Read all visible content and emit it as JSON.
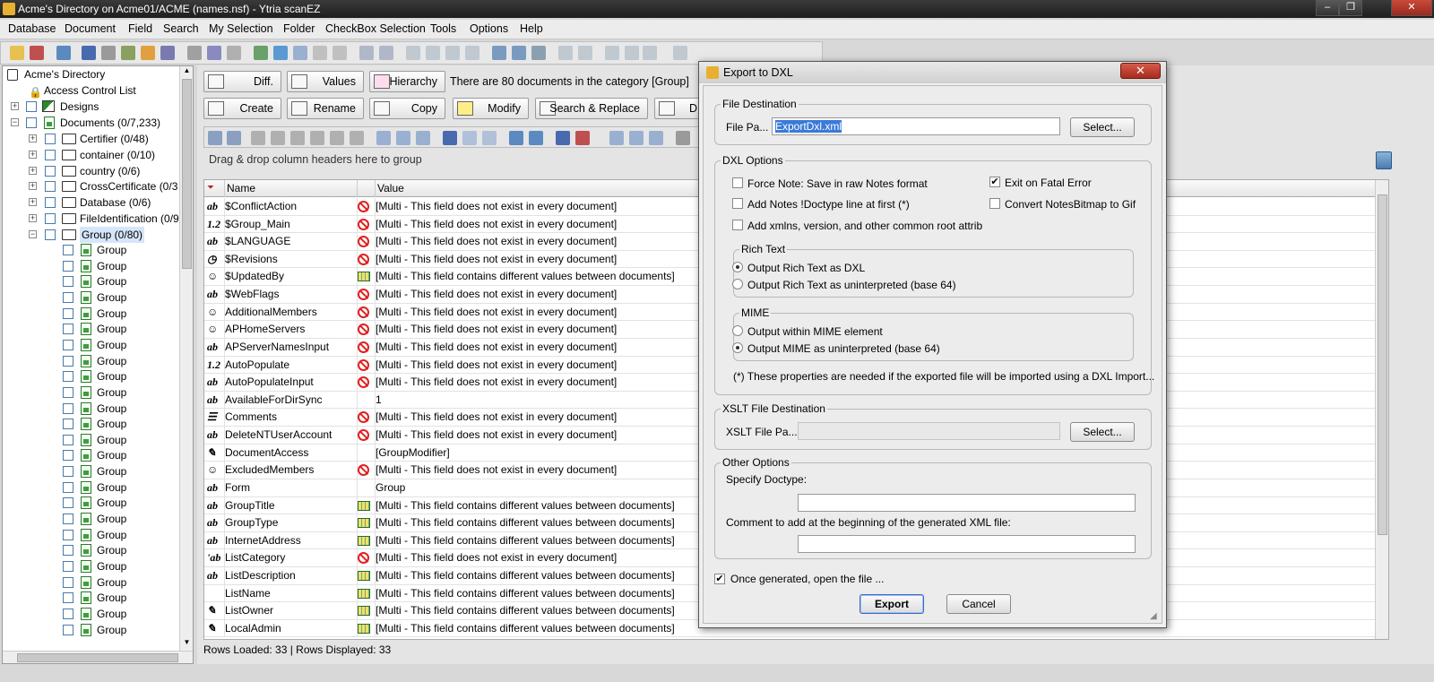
{
  "window": {
    "title": "Acme's Directory on Acme01/ACME (names.nsf) - Ytria scanEZ",
    "close": "✕",
    "maximize": "❐",
    "minimize": "–"
  },
  "menu": [
    "Database",
    "Document",
    "Field",
    "Search",
    "My Selection",
    "Folder",
    "CheckBox Selection",
    "Tools",
    "Options",
    "Help"
  ],
  "tree": {
    "root": "Acme's Directory",
    "acl": "Access Control List",
    "designs": "Designs",
    "documents": "Documents  (0/7,233)",
    "folders": [
      "Certifier  (0/48)",
      "container  (0/10)",
      "country  (0/6)",
      "CrossCertificate  (0/3",
      "Database  (0/6)",
      "FileIdentification  (0/9",
      "Group  (0/80)"
    ],
    "child_label": "Group",
    "child_count": 26
  },
  "buttons": {
    "diff": "Diff.",
    "values": "Values",
    "hierarchy": "Hierarchy",
    "create": "Create",
    "rename": "Rename",
    "copy": "Copy",
    "modify": "Modify",
    "search_replace": "Search & Replace",
    "d": "D"
  },
  "category_info": "There are 80 documents in the category [Group]",
  "group_hint": "Drag & drop column headers here to group",
  "grid": {
    "col_name": "Name",
    "col_value": "Value",
    "rows": [
      {
        "t": "ab",
        "n": "$ConflictAction",
        "i": "no",
        "v": "[Multi - This field does not exist in every document]"
      },
      {
        "t": "1.2",
        "n": "$Group_Main",
        "i": "no",
        "v": "[Multi - This field does not exist in every document]"
      },
      {
        "t": "ab",
        "n": "$LANGUAGE",
        "i": "no",
        "v": "[Multi - This field does not exist in every document]"
      },
      {
        "t": "◷",
        "n": "$Revisions",
        "i": "no",
        "v": "[Multi - This field does not exist in every document]"
      },
      {
        "t": "☺",
        "n": "$UpdatedBy",
        "i": "ml",
        "v": "[Multi - This field contains different values between documents]"
      },
      {
        "t": "ab",
        "n": "$WebFlags",
        "i": "no",
        "v": "[Multi - This field does not exist in every document]"
      },
      {
        "t": "☺",
        "n": "AdditionalMembers",
        "i": "no",
        "v": "[Multi - This field does not exist in every document]"
      },
      {
        "t": "☺",
        "n": "APHomeServers",
        "i": "no",
        "v": "[Multi - This field does not exist in every document]"
      },
      {
        "t": "ab",
        "n": "APServerNamesInput",
        "i": "no",
        "v": "[Multi - This field does not exist in every document]"
      },
      {
        "t": "1.2",
        "n": "AutoPopulate",
        "i": "no",
        "v": "[Multi - This field does not exist in every document]"
      },
      {
        "t": "ab",
        "n": "AutoPopulateInput",
        "i": "no",
        "v": "[Multi - This field does not exist in every document]"
      },
      {
        "t": "ab",
        "n": "AvailableForDirSync",
        "i": "",
        "v": "1"
      },
      {
        "t": "☰",
        "n": "Comments",
        "i": "no",
        "v": "[Multi - This field does not exist in every document]"
      },
      {
        "t": "ab",
        "n": "DeleteNTUserAccount",
        "i": "no",
        "v": "[Multi - This field does not exist in every document]"
      },
      {
        "t": "✎",
        "n": "DocumentAccess",
        "i": "",
        "v": "[GroupModifier]"
      },
      {
        "t": "☺",
        "n": "ExcludedMembers",
        "i": "no",
        "v": "[Multi - This field does not exist in every document]"
      },
      {
        "t": "ab",
        "n": "Form",
        "i": "",
        "v": "Group"
      },
      {
        "t": "ab",
        "n": "GroupTitle",
        "i": "ml",
        "v": "[Multi - This field contains different values between documents]"
      },
      {
        "t": "ab",
        "n": "GroupType",
        "i": "ml",
        "v": "[Multi - This field contains different values between documents]"
      },
      {
        "t": "ab",
        "n": "InternetAddress",
        "i": "ml",
        "v": "[Multi - This field contains different values between documents]"
      },
      {
        "t": "'ab",
        "n": "ListCategory",
        "i": "no",
        "v": "[Multi - This field does not exist in every document]"
      },
      {
        "t": "ab",
        "n": "ListDescription",
        "i": "ml",
        "v": "[Multi - This field contains different values between documents]"
      },
      {
        "t": "",
        "n": "ListName",
        "i": "ml",
        "v": "[Multi - This field contains different values between documents]"
      },
      {
        "t": "✎",
        "n": "ListOwner",
        "i": "ml",
        "v": "[Multi - This field contains different values between documents]"
      },
      {
        "t": "✎",
        "n": "LocalAdmin",
        "i": "ml",
        "v": "[Multi - This field contains different values between documents]"
      }
    ]
  },
  "status": "Rows Loaded: 33  |  Rows Displayed: 33",
  "dialog": {
    "title": "Export to DXL",
    "close": "✕",
    "file_destination": "File Destination",
    "file_path_label": "File Pa...",
    "file_path_value": "ExportDxl.xml",
    "select": "Select...",
    "dxl_options": "DXL Options",
    "force_note": "Force Note: Save in raw Notes format",
    "add_doctype": "Add Notes !Doctype line at first (*)",
    "add_xmlns": "Add xmlns, version, and other common root attrib",
    "exit_fatal": "Exit on Fatal Error",
    "convert_bitmap": "Convert NotesBitmap to Gif",
    "rich_text": "Rich Text",
    "rt_dxl": "Output Rich Text as DXL",
    "rt_uninterp": "Output Rich Text as uninterpreted (base 64)",
    "mime": "MIME",
    "mime_within": "Output within MIME element",
    "mime_uninterp": "Output MIME as uninterpreted (base 64)",
    "note": "(*) These properties are needed if the exported file will be imported using a DXL Import...",
    "xslt_dest": "XSLT File Destination",
    "xslt_label": "XSLT File Pa...",
    "xslt_select": "Select...",
    "other_options": "Other Options",
    "specify_doctype": "Specify Doctype:",
    "comment_label": "Comment to add at the beginning of the generated XML file:",
    "open_file": "Once generated, open the file ...",
    "export": "Export",
    "cancel": "Cancel",
    "check_mark": "✔"
  }
}
